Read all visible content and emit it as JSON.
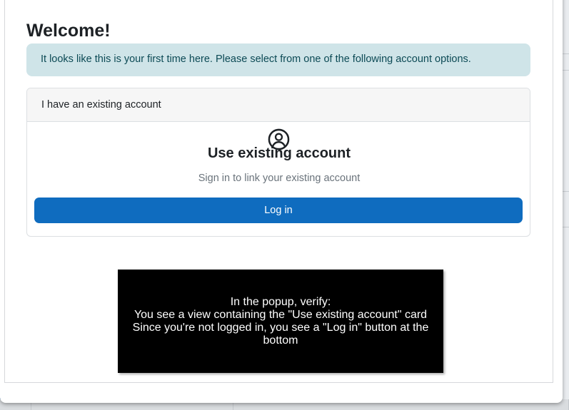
{
  "popup": {
    "title": "Welcome!",
    "alert_text": "It looks like this is your first time here. Please select from one of the following account options."
  },
  "card": {
    "header": "I have an existing account",
    "icon": "user-circle-icon",
    "title": "Use existing account",
    "subtitle": "Sign in to link your existing account",
    "button_label": "Log in"
  },
  "overlay": {
    "lines": [
      "In the popup, verify:",
      "You see a view containing the \"Use existing account\" card",
      "Since you're not logged in, you see a \"Log in\" button at the bottom"
    ]
  },
  "colors": {
    "primary": "#0f6cbf",
    "alert_bg": "#cfe4e8",
    "alert_text": "#0c4a55",
    "backdrop": "#2a6aa6"
  }
}
